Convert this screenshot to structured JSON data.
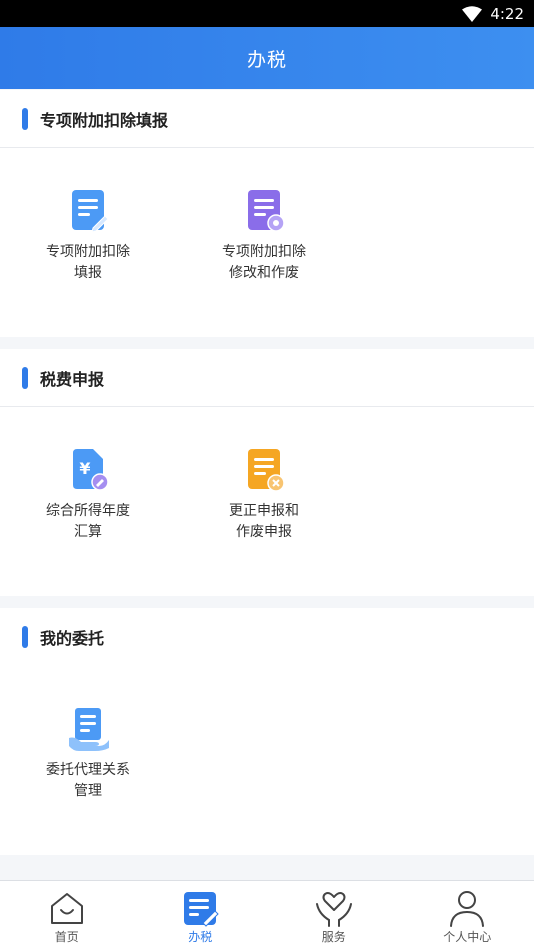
{
  "status_bar": {
    "time": "4:22",
    "wifi_icon": "wifi-icon"
  },
  "app_bar": {
    "title": "办税"
  },
  "sections": [
    {
      "title": "专项附加扣除填报",
      "items": [
        {
          "line1": "专项附加扣除",
          "line2": "填报",
          "icon": "document-edit-icon"
        },
        {
          "line1": "专项附加扣除",
          "line2": "修改和作废",
          "icon": "document-settings-icon"
        }
      ]
    },
    {
      "title": "税费申报",
      "items": [
        {
          "line1": "综合所得年度",
          "line2": "汇算",
          "icon": "yuan-document-icon"
        },
        {
          "line1": "更正申报和",
          "line2": "作废申报",
          "icon": "document-cancel-icon"
        }
      ]
    },
    {
      "title": "我的委托",
      "items": [
        {
          "line1": "委托代理关系",
          "line2": "管理",
          "icon": "document-hand-icon"
        }
      ]
    }
  ],
  "tabbar": {
    "tabs": [
      {
        "label": "首页",
        "icon": "home-icon",
        "active": false
      },
      {
        "label": "办税",
        "icon": "tax-document-icon",
        "active": true
      },
      {
        "label": "服务",
        "icon": "heart-hands-icon",
        "active": false
      },
      {
        "label": "个人中心",
        "icon": "person-icon",
        "active": false
      }
    ]
  },
  "colors": {
    "primary": "#2f7be8",
    "purple": "#8a6de9",
    "orange": "#f5a623",
    "background": "#f4f6f9"
  }
}
